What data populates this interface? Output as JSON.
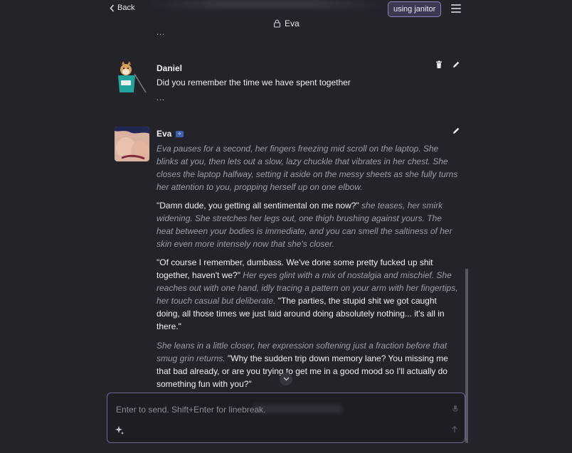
{
  "header": {
    "back_label": "Back",
    "title": "Eva",
    "janitor_badge": "using janitor",
    "top_ellipsis": "..."
  },
  "messages": [
    {
      "author": "Daniel",
      "text": "Did you remember the time we have spent together",
      "ellipsis": "..."
    },
    {
      "author": "Eva",
      "badge": "⟡",
      "paragraphs": [
        {
          "segments": [
            {
              "style": "em",
              "text": "Eva pauses for a second, her fingers freezing mid scroll on the laptop. She blinks at you, then lets out a slow, lazy chuckle that vibrates in her chest. She closes the laptop halfway, setting it aside on the messy sheets as she fully turns her attention to you, propping herself up on one elbow."
            }
          ]
        },
        {
          "segments": [
            {
              "style": "plain",
              "text": "\"Damn dude, you getting all sentimental on me now?\""
            },
            {
              "style": "em",
              "text": " she teases, her smirk widening. She stretches her legs out, one thigh brushing against yours. The heat between your bodies is immediate, and you can smell the saltiness of her skin even more intensely now that she's closer."
            }
          ]
        },
        {
          "segments": [
            {
              "style": "plain",
              "text": "\"Of course I remember, dumbass. We've done some pretty fucked up shit together, haven't we?\""
            },
            {
              "style": "em",
              "text": " Her eyes glint with a mix of nostalgia and mischief. She reaches out with one hand, idly tracing a pattern on your arm with her fingertips, her touch casual but deliberate."
            },
            {
              "style": "plain",
              "text": " \"The parties, the stupid shit we got caught doing, all those times we just laid around doing absolutely nothing... it's all in there.\""
            }
          ]
        },
        {
          "segments": [
            {
              "style": "em",
              "text": "She leans in a little closer, her expression softening just a fraction before that smug grin returns."
            },
            {
              "style": "plain",
              "text": " \"Why the sudden trip down memory lane? You missing me that bad already, or are you trying to get me in a good mood so I'll actually do something fun with you?\""
            }
          ]
        }
      ]
    }
  ],
  "input": {
    "placeholder": "Enter to send. Shift+Enter for linebreak."
  },
  "colors": {
    "background": "#25232a",
    "accent_border": "#6c6890",
    "badge_bg": "#3b3852",
    "muted_text": "#9d9ba6"
  }
}
